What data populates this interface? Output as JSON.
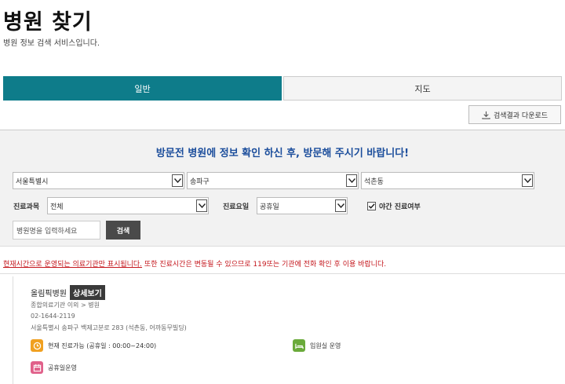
{
  "page": {
    "title": "병원 찾기",
    "subtitle": "병원 정보 검색 서비스입니다."
  },
  "tabs": [
    {
      "label": "일반",
      "active": true
    },
    {
      "label": "지도",
      "active": false
    }
  ],
  "toolbar": {
    "download_label": "검색결과 다운로드",
    "download_icon": "download-icon"
  },
  "search": {
    "notice": "방문전 병원에 정보 확인 하신 후, 방문해 주시기 바랍니다!",
    "region": {
      "sido": "서울특별시",
      "sigungu": "송파구",
      "dong": "석촌동"
    },
    "department_label": "진료과목",
    "department_value": "전체",
    "day_label": "진료요일",
    "day_value": "공휴일",
    "night_checkbox_label": "야간 진료여부",
    "night_checked": true,
    "name_placeholder": "병원명을 입력하세요",
    "search_button": "검색"
  },
  "warning": {
    "underlined": "현재시간으로 운영되는 의료기관만 표시됩니다.",
    "rest": " 또한 진료시간은 변동될 수 있으므로 119또는 기관에 전화 확인 후 이용 바랍니다."
  },
  "results": [
    {
      "name": "올림픽병원",
      "detail_button": "상세보기",
      "category": "종합의료기관 이외 > 병원",
      "phone": "02-1644-2119",
      "address": "서울특별시 송파구 백제고분로 283 (석촌동, 어까동무빌딩)",
      "hours_status": "현재 진료가능 (공휴일 : 00:00~24:00)",
      "inpatient": "입원실 운영",
      "holiday": "공휴일운영"
    }
  ],
  "colors": {
    "accent": "#0e7c8a",
    "notice": "#1c4e9c",
    "warning": "#c4161c"
  }
}
